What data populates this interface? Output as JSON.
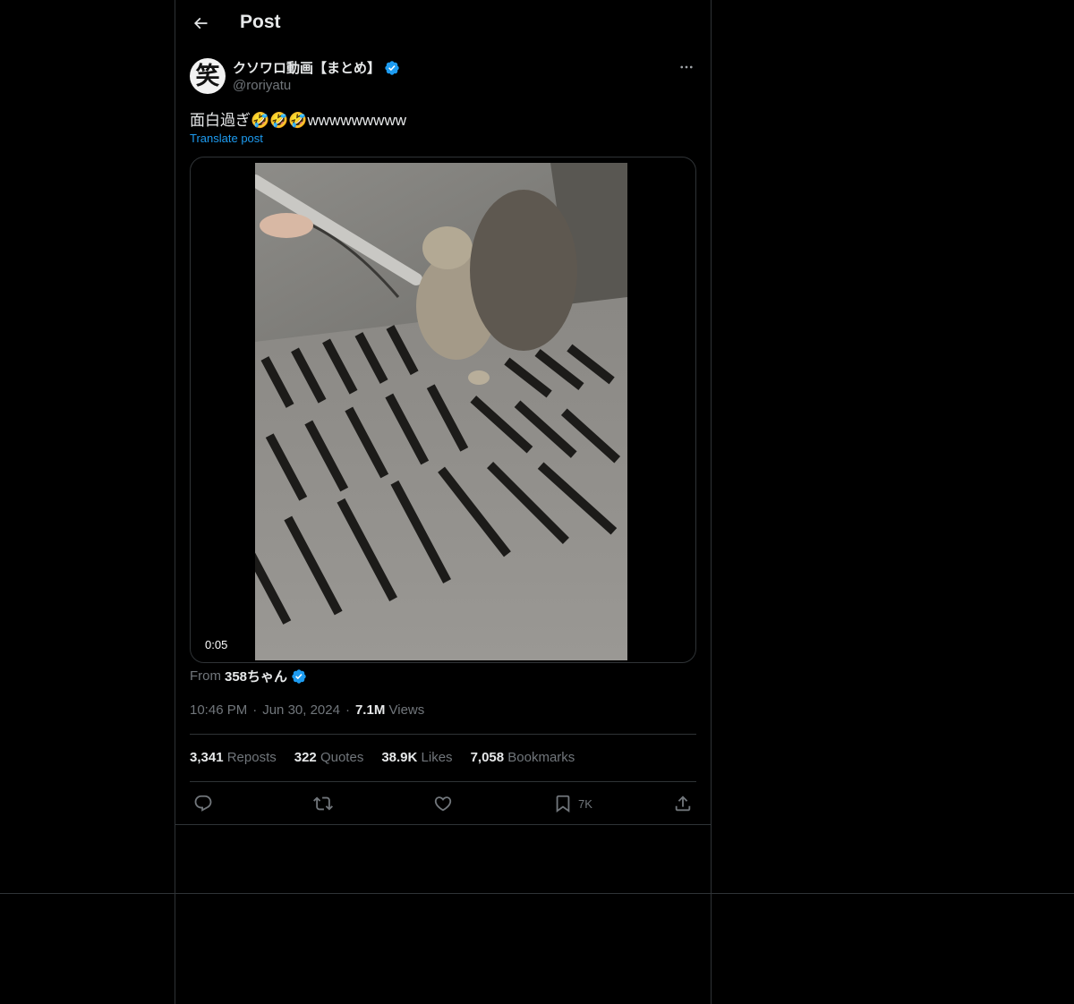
{
  "header": {
    "title": "Post"
  },
  "author": {
    "display_name": "クソワロ動画【まとめ】",
    "handle": "@roriyatu",
    "avatar_glyph": "笑",
    "verified": true
  },
  "post": {
    "text": "面白過ぎ🤣🤣🤣wwwwwwwww",
    "translate_label": "Translate post",
    "video_duration": "0:05"
  },
  "source": {
    "prefix": "From",
    "name": "358ちゃん",
    "verified": true
  },
  "meta": {
    "time": "10:46 PM",
    "separator": "·",
    "date": "Jun 30, 2024",
    "views_count": "7.1M",
    "views_label": "Views"
  },
  "stats": {
    "reposts_count": "3,341",
    "reposts_label": "Reposts",
    "quotes_count": "322",
    "quotes_label": "Quotes",
    "likes_count": "38.9K",
    "likes_label": "Likes",
    "bookmarks_count": "7,058",
    "bookmarks_label": "Bookmarks"
  },
  "actions": {
    "bookmark_count": "7K"
  },
  "colors": {
    "background": "#000000",
    "text": "#e7e9ea",
    "muted": "#71767b",
    "accent": "#1d9bf0",
    "border": "#2f3336"
  },
  "icons": [
    "back-arrow-icon",
    "verified-badge-icon",
    "more-icon",
    "reply-icon",
    "repost-icon",
    "like-icon",
    "bookmark-icon",
    "share-icon"
  ]
}
